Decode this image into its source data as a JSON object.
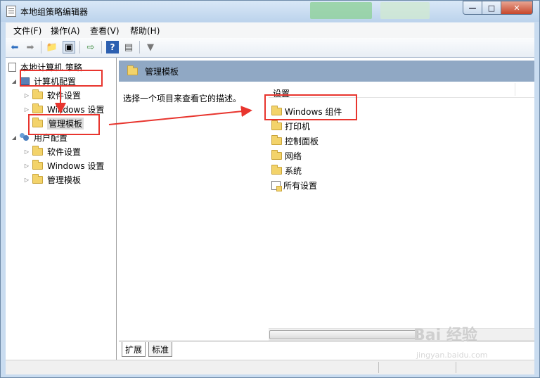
{
  "window": {
    "title": "本地组策略编辑器"
  },
  "controls": {
    "minimize": "—",
    "maximize": "□",
    "close": "✕"
  },
  "menu": [
    {
      "label": "文件(F)"
    },
    {
      "label": "操作(A)"
    },
    {
      "label": "查看(V)"
    },
    {
      "label": "帮助(H)"
    }
  ],
  "toolbar": {
    "icons": [
      "back-arrow-icon",
      "forward-arrow-icon",
      "folder-up-icon",
      "show-tree-icon",
      "export-icon",
      "help-icon",
      "properties-icon",
      "filter-icon"
    ]
  },
  "tree": {
    "root": "本地计算机 策略",
    "computer_config": "计算机配置",
    "computer_children": [
      "软件设置",
      "Windows 设置",
      "管理模板"
    ],
    "user_config": "用户配置",
    "user_children": [
      "软件设置",
      "Windows 设置",
      "管理模板"
    ]
  },
  "right": {
    "header": "管理模板",
    "description": "选择一个项目来查看它的描述。",
    "column_header": "设置",
    "items": [
      "Windows 组件",
      "打印机",
      "控制面板",
      "网络",
      "系统",
      "所有设置"
    ]
  },
  "tabs": [
    {
      "label": "扩展"
    },
    {
      "label": "标准"
    }
  ],
  "watermark": {
    "brand": "Bai 经验",
    "url": "jingyan.baidu.com"
  },
  "annotation_color": "#e8352e"
}
